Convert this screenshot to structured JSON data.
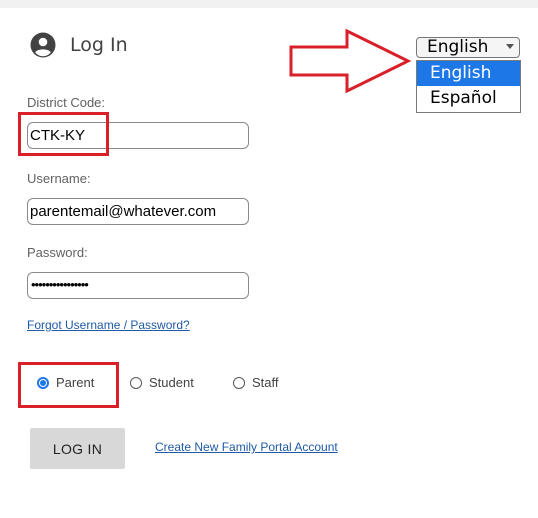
{
  "login": {
    "title": "Log In",
    "district_label": "District Code:",
    "district_value": "CTK-KY",
    "username_label": "Username:",
    "username_value": "parentemail@whatever.com",
    "password_label": "Password:",
    "password_value": "••••••••••••••••",
    "forgot_link": "Forgot Username / Password?",
    "login_button": "LOG IN",
    "create_account_link": "Create New Family Portal Account"
  },
  "language": {
    "selected": "English",
    "options": [
      "English",
      "Español"
    ]
  },
  "roles": {
    "selected": "Parent",
    "options": [
      "Parent",
      "Student",
      "Staff"
    ]
  },
  "icons": {
    "user": "user-circle-icon",
    "arrow": "right-arrow-annotation-icon",
    "dropdown": "chevron-down-icon"
  },
  "colors": {
    "accent": "#1e77e6",
    "annotation": "#d9202a",
    "link": "#1f5aa6",
    "button": "#d8d8d8"
  }
}
